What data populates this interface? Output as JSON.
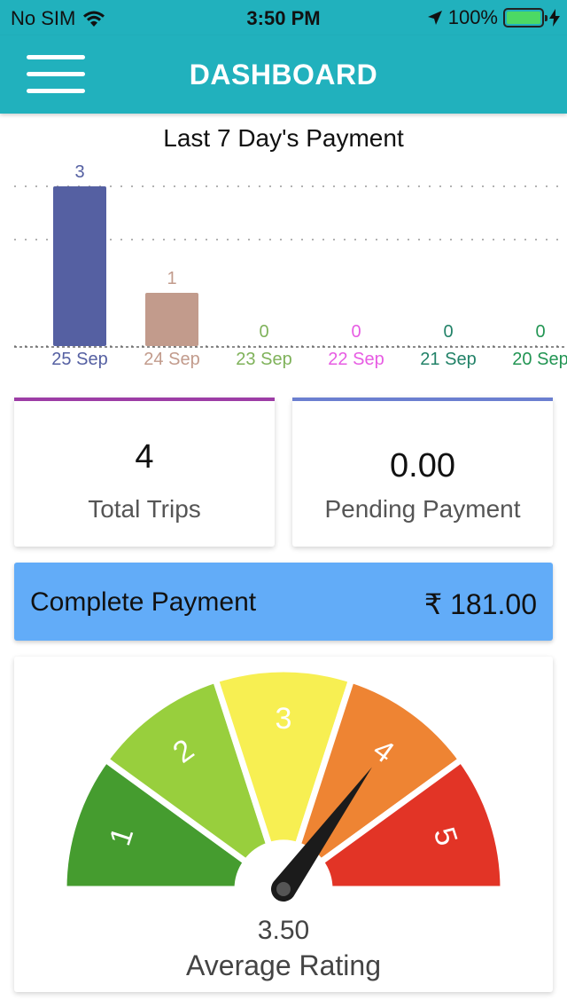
{
  "status_bar": {
    "carrier": "No SIM",
    "time": "3:50 PM",
    "battery": "100%"
  },
  "header": {
    "title": "DASHBOARD",
    "menu_icon": "hamburger-menu-icon"
  },
  "chart_data": {
    "type": "bar",
    "title": "Last 7 Day's Payment",
    "categories": [
      "25 Sep",
      "24 Sep",
      "23 Sep",
      "22 Sep",
      "21 Sep",
      "20 Sep"
    ],
    "values": [
      3,
      1,
      0,
      0,
      0,
      0
    ],
    "colors": [
      "#5560a2",
      "#c29b8c",
      "#7fb25a",
      "#e75ce3",
      "#228268",
      "#229553"
    ],
    "ylim": [
      0,
      3
    ],
    "grid": true
  },
  "cards": {
    "total_trips": {
      "value": "4",
      "label": "Total Trips",
      "accent": "#9d3da6"
    },
    "pending_payment": {
      "value": "0.00",
      "label": "Pending Payment",
      "accent": "#6b7fd0"
    }
  },
  "complete_payment": {
    "label": "Complete Payment",
    "amount": "₹ 181.00",
    "color": "#62acf8"
  },
  "rating": {
    "value": 3.5,
    "display": "3.50",
    "label": "Average Rating",
    "segments": [
      {
        "label": "1",
        "color": "#459c2f"
      },
      {
        "label": "2",
        "color": "#98cf3d"
      },
      {
        "label": "3",
        "color": "#f7ef52"
      },
      {
        "label": "4",
        "color": "#ee8433"
      },
      {
        "label": "5",
        "color": "#e23426"
      }
    ]
  }
}
